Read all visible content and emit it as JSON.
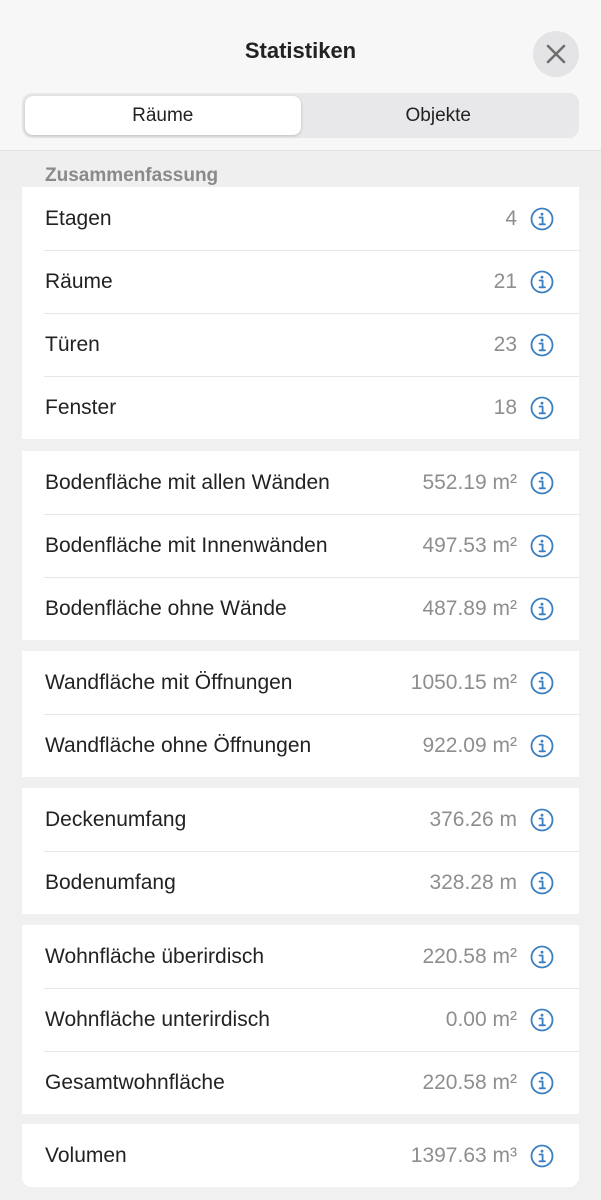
{
  "header": {
    "title": "Statistiken",
    "close_icon": "close-icon"
  },
  "tabs": [
    {
      "label": "Räume",
      "active": true
    },
    {
      "label": "Objekte",
      "active": false
    }
  ],
  "section": {
    "title": "Zusammenfassung"
  },
  "groups": [
    {
      "rows": [
        {
          "label": "Etagen",
          "value": "4"
        },
        {
          "label": "Räume",
          "value": "21"
        },
        {
          "label": "Türen",
          "value": "23"
        },
        {
          "label": "Fenster",
          "value": "18"
        }
      ]
    },
    {
      "rows": [
        {
          "label": "Bodenfläche mit allen Wänden",
          "value": "552.19 m²"
        },
        {
          "label": "Bodenfläche mit Innenwänden",
          "value": "497.53 m²"
        },
        {
          "label": "Bodenfläche ohne Wände",
          "value": "487.89 m²"
        }
      ]
    },
    {
      "rows": [
        {
          "label": "Wandfläche mit Öffnungen",
          "value": "1050.15 m²"
        },
        {
          "label": "Wandfläche ohne Öffnungen",
          "value": "922.09 m²"
        }
      ]
    },
    {
      "rows": [
        {
          "label": "Deckenumfang",
          "value": "376.26 m"
        },
        {
          "label": "Bodenumfang",
          "value": "328.28 m"
        }
      ]
    },
    {
      "rows": [
        {
          "label": "Wohnfläche überirdisch",
          "value": "220.58 m²"
        },
        {
          "label": "Wohnfläche unterirdisch",
          "value": "0.00 m²"
        },
        {
          "label": "Gesamtwohnfläche",
          "value": "220.58 m²"
        }
      ]
    },
    {
      "rows": [
        {
          "label": "Volumen",
          "value": "1397.63 m³"
        }
      ]
    }
  ],
  "colors": {
    "accent": "#3a7fc1",
    "value_text": "#8e8e8e",
    "background": "#f0f0f0"
  },
  "row_icon": "info-icon"
}
